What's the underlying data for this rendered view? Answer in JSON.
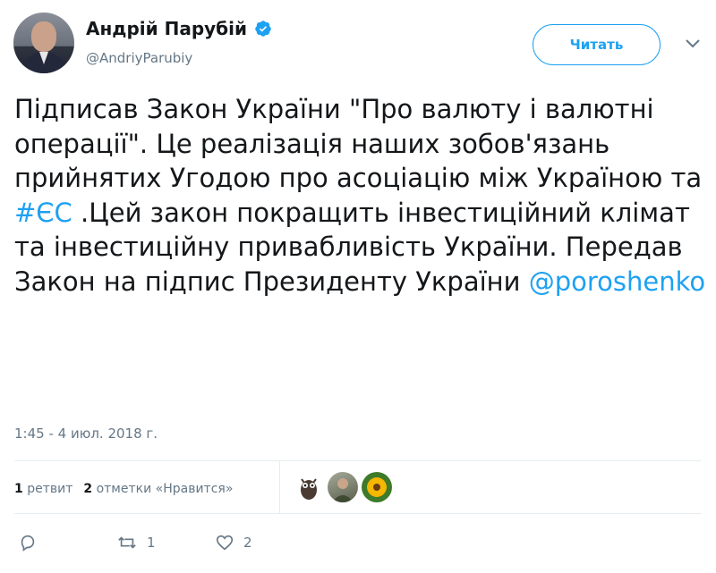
{
  "author": {
    "name": "Андрій Парубій",
    "handle": "@AndriyParubiy"
  },
  "follow_button": {
    "label": "Читать"
  },
  "tweet": {
    "text_parts": [
      "Підписав Закон України \"Про валюту і валютні операції\". Це реалізація наших зобов'язань прийнятих Угодою про асоціацію між Україною та ",
      "#ЄС",
      " .Цей закон покращить інвестиційний клімат та інвестиційну привабливість України. Передав Закон на підпис Президенту України ",
      "@poroshenko"
    ],
    "timestamp": "1:45 - 4 июл. 2018 г."
  },
  "stats": {
    "retweets_count": "1",
    "retweets_label": "ретвит",
    "likes_count": "2",
    "likes_label": "отметки «Нравится»"
  },
  "actions": {
    "reply_count": "",
    "retweet_count": "1",
    "like_count": "2"
  },
  "icons": {
    "verified": "verified-badge-icon",
    "chevron": "chevron-down-icon",
    "reply": "reply-icon",
    "retweet": "retweet-icon",
    "like": "heart-icon"
  },
  "colors": {
    "accent": "#1da1f2",
    "text": "#14171a",
    "muted": "#657786"
  }
}
